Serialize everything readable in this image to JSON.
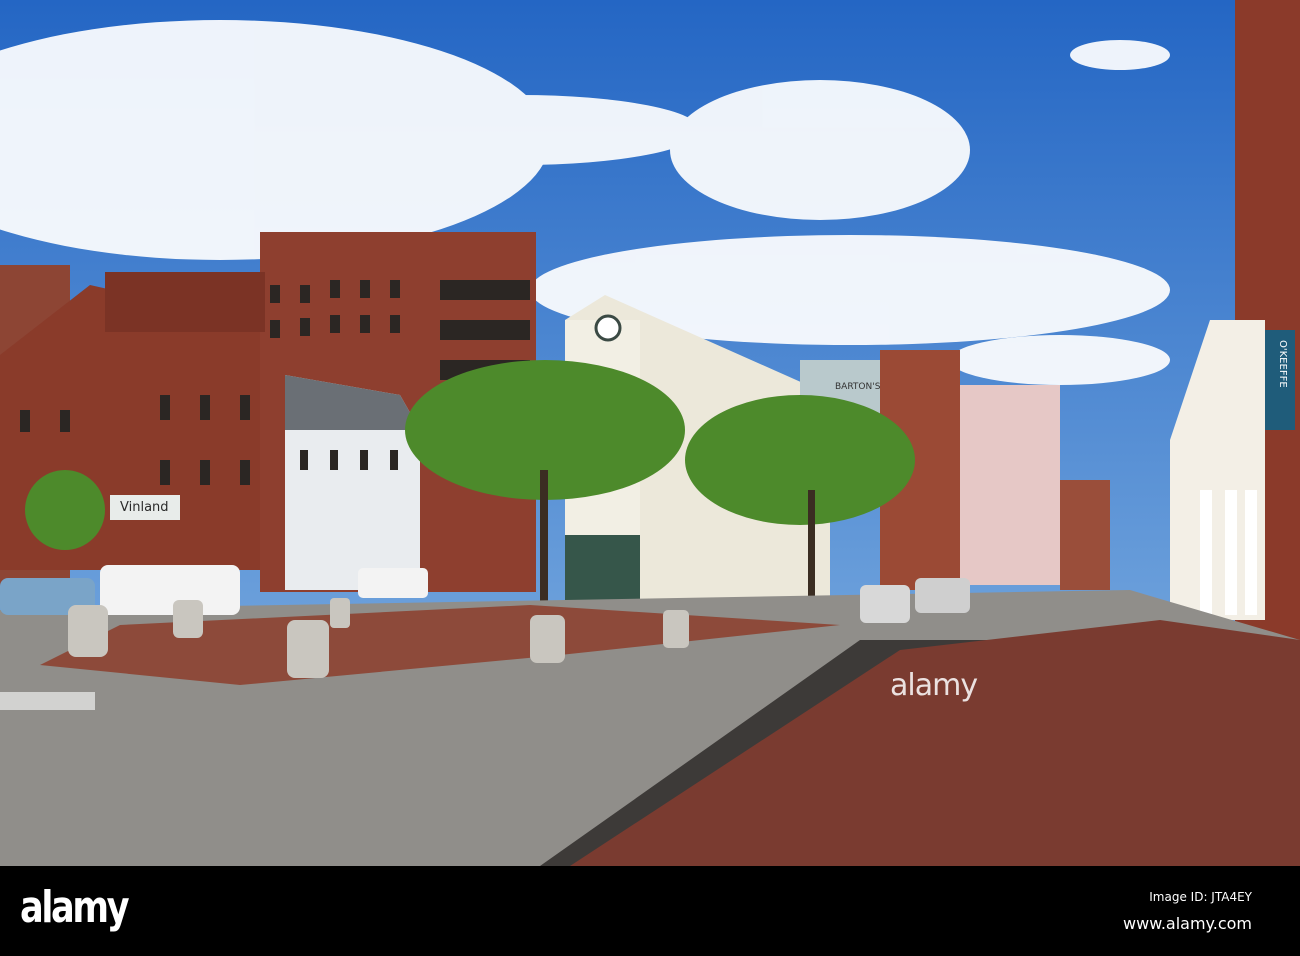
{
  "photo": {
    "scene": "street",
    "signs": {
      "vinland": "Vinland",
      "okeeffe": "O'KEEFFE",
      "bartons": "BARTON'S"
    },
    "colors": {
      "sky": "#2f72c8",
      "brick": "#8a3b2a",
      "road": "#8f8d89",
      "sidewalk": "#7a3f33",
      "foliage": "#4f8a2a"
    }
  },
  "watermark": {
    "logo": "alamy",
    "overlay_text": "alamy",
    "image_id": "Image ID: JTA4EY",
    "site": "www.alamy.com"
  }
}
